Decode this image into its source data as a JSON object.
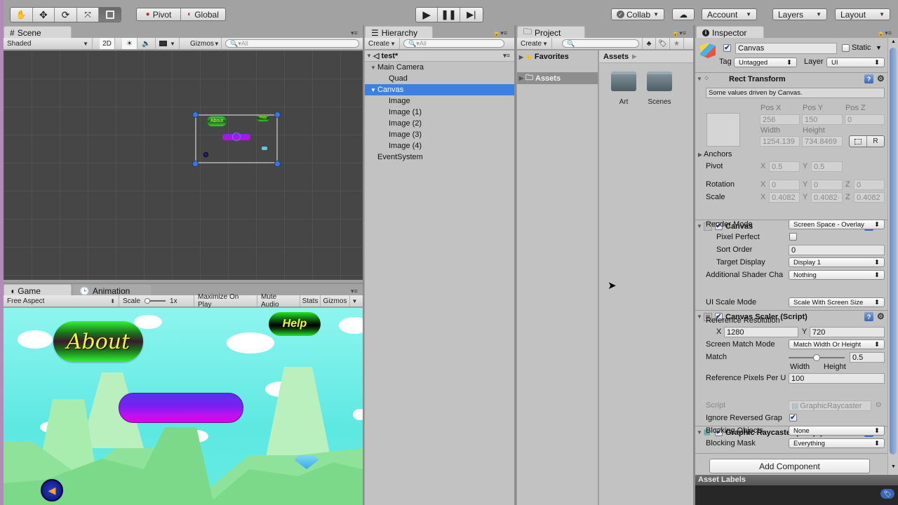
{
  "toolbar": {
    "tools": [
      "hand-tool",
      "move-tool",
      "rotate-tool",
      "scale-tool",
      "rect-tool"
    ],
    "pivot_label": "Pivot",
    "global_label": "Global",
    "play_icons": [
      "play",
      "pause",
      "step"
    ],
    "collab_label": "Collab",
    "account_label": "Account",
    "layers_label": "Layers",
    "layout_label": "Layout"
  },
  "scene": {
    "tab_label": "Scene",
    "shading_mode": "Shaded",
    "mode_2d": "2D",
    "gizmos_label": "Gizmos",
    "search_placeholder": "All",
    "preview_labels": {
      "about": "About",
      "help": "Help"
    }
  },
  "game": {
    "tab_label": "Game",
    "animation_tab_label": "Animation",
    "aspect": "Free Aspect",
    "scale_label": "Scale",
    "scale_value": "1x",
    "maximize_label": "Maximize On Play",
    "mute_label": "Mute Audio",
    "stats_label": "Stats",
    "gizmos_label": "Gizmos",
    "about_button": "About",
    "help_button": "Help"
  },
  "hierarchy": {
    "tab_label": "Hierarchy",
    "create_label": "Create",
    "search_placeholder": "All",
    "scene_name": "test*",
    "items": [
      {
        "label": "Main Camera",
        "depth": 1,
        "expandable": true,
        "selected": false
      },
      {
        "label": "Quad",
        "depth": 2,
        "expandable": false,
        "selected": false
      },
      {
        "label": "Canvas",
        "depth": 1,
        "expandable": true,
        "selected": true
      },
      {
        "label": "Image",
        "depth": 2,
        "expandable": false,
        "selected": false
      },
      {
        "label": "Image (1)",
        "depth": 2,
        "expandable": false,
        "selected": false
      },
      {
        "label": "Image (2)",
        "depth": 2,
        "expandable": false,
        "selected": false
      },
      {
        "label": "Image (3)",
        "depth": 2,
        "expandable": false,
        "selected": false
      },
      {
        "label": "Image (4)",
        "depth": 2,
        "expandable": false,
        "selected": false
      },
      {
        "label": "EventSystem",
        "depth": 1,
        "expandable": false,
        "selected": false
      }
    ]
  },
  "project": {
    "tab_label": "Project",
    "create_label": "Create",
    "favorites_label": "Favorites",
    "assets_tree_label": "Assets",
    "breadcrumb": "Assets",
    "folders": [
      "Art",
      "Scenes"
    ]
  },
  "inspector": {
    "tab_label": "Inspector",
    "object_name": "Canvas",
    "active": true,
    "static_label": "Static",
    "tag_label": "Tag",
    "tag_value": "Untagged",
    "layer_label": "Layer",
    "layer_value": "UI",
    "rect_transform": {
      "title": "Rect Transform",
      "note": "Some values driven by Canvas.",
      "pos_x_label": "Pos X",
      "pos_y_label": "Pos Y",
      "pos_z_label": "Pos Z",
      "pos_x": "256",
      "pos_y": "150",
      "pos_z": "0",
      "width_label": "Width",
      "height_label": "Height",
      "width": "1254.139",
      "height": "734.8469",
      "r_button": "R",
      "anchors_label": "Anchors",
      "pivot_label": "Pivot",
      "pivot_x": "0.5",
      "pivot_y": "0.5",
      "rotation_label": "Rotation",
      "rot_x": "0",
      "rot_y": "0",
      "rot_z": "0",
      "scale_label": "Scale",
      "scale_x": "0.4082",
      "scale_y": "0.4082·",
      "scale_z": "0.4082",
      "axis_x": "X",
      "axis_y": "Y",
      "axis_z": "Z"
    },
    "canvas": {
      "title": "Canvas",
      "render_mode_label": "Render Mode",
      "render_mode": "Screen Space - Overlay",
      "pixel_perfect_label": "Pixel Perfect",
      "pixel_perfect": false,
      "sort_order_label": "Sort Order",
      "sort_order": "0",
      "target_display_label": "Target Display",
      "target_display": "Display 1",
      "shader_channels_label": "Additional Shader Cha",
      "shader_channels": "Nothing"
    },
    "canvas_scaler": {
      "title": "Canvas Scaler (Script)",
      "ui_scale_mode_label": "UI Scale Mode",
      "ui_scale_mode": "Scale With Screen Size",
      "ref_res_label": "Reference Resolution",
      "ref_x_label": "X",
      "ref_x": "1280",
      "ref_y_label": "Y",
      "ref_y": "720",
      "match_mode_label": "Screen Match Mode",
      "match_mode": "Match Width Or Height",
      "match_label": "Match",
      "match_value": "0.5",
      "match_fraction": 0.5,
      "width_label": "Width",
      "height_label": "Height",
      "ref_ppu_label": "Reference Pixels Per U",
      "ref_ppu": "100"
    },
    "graphic_raycaster": {
      "title": "Graphic Raycaster (Script)",
      "script_label": "Script",
      "script_value": "GraphicRaycaster",
      "ignore_reversed_label": "Ignore Reversed Grap",
      "ignore_reversed": true,
      "blocking_objects_label": "Blocking Objects",
      "blocking_objects": "None",
      "blocking_mask_label": "Blocking Mask",
      "blocking_mask": "Everything"
    },
    "add_component_label": "Add Component",
    "asset_labels_title": "Asset Labels"
  }
}
